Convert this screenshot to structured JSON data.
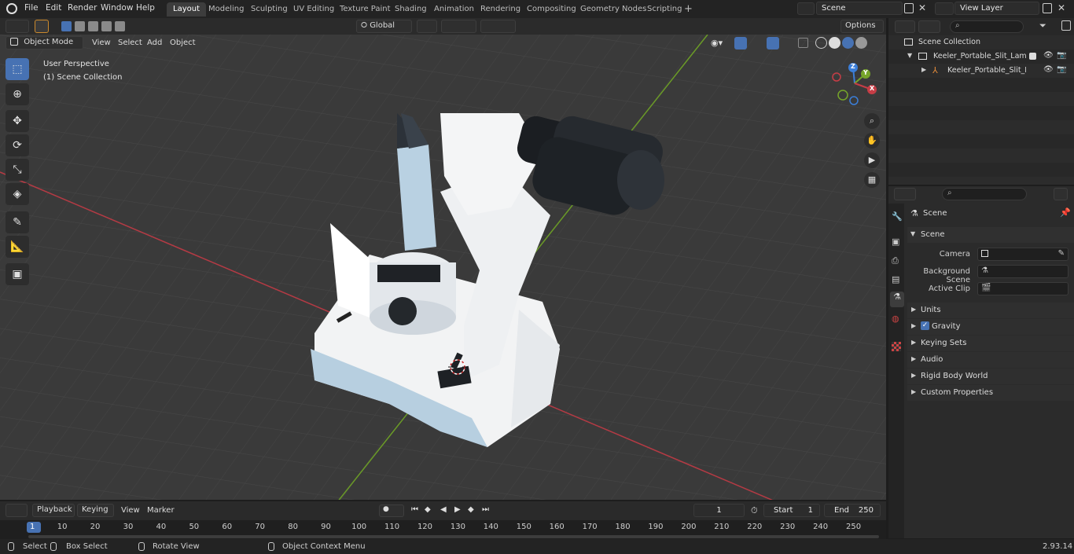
{
  "menu": [
    "File",
    "Edit",
    "Render",
    "Window",
    "Help"
  ],
  "workspaces": [
    "Layout",
    "Modeling",
    "Sculpting",
    "UV Editing",
    "Texture Paint",
    "Shading",
    "Animation",
    "Rendering",
    "Compositing",
    "Geometry Nodes",
    "Scripting"
  ],
  "active_workspace": "Layout",
  "scene_field": "Scene",
  "view_layer_field": "View Layer",
  "viewport_header": {
    "mode": "Object Mode",
    "links": [
      "View",
      "Select",
      "Add",
      "Object"
    ],
    "orientation": "Global",
    "options": "Options"
  },
  "viewport_overlay": {
    "perspective": "User Perspective",
    "collection": "(1) Scene Collection"
  },
  "gizmo": {
    "z": "Z",
    "y": "Y",
    "x": "X"
  },
  "outliner": {
    "root": "Scene Collection",
    "items": [
      "Keeler_Portable_Slit_Lamp_Cl",
      "Keeler_Portable_Slit_Larr"
    ]
  },
  "properties": {
    "header": "Scene",
    "section": "Scene",
    "fields": [
      {
        "label": "Camera"
      },
      {
        "label": "Background Scene"
      },
      {
        "label": "Active Clip"
      }
    ],
    "panels": [
      "Units",
      "Gravity",
      "Keying Sets",
      "Audio",
      "Rigid Body World",
      "Custom Properties"
    ]
  },
  "timeline": {
    "menus": [
      "Playback",
      "Keying",
      "View",
      "Marker"
    ],
    "current_frame": "1",
    "start_label": "Start",
    "start_value": "1",
    "end_label": "End",
    "end_value": "250",
    "ticks": [
      "1",
      "10",
      "20",
      "30",
      "40",
      "50",
      "60",
      "70",
      "80",
      "90",
      "100",
      "110",
      "120",
      "130",
      "140",
      "150",
      "160",
      "170",
      "180",
      "190",
      "200",
      "210",
      "220",
      "230",
      "240",
      "250"
    ]
  },
  "status": {
    "select": "Select",
    "box_select": "Box Select",
    "rotate_view": "Rotate View",
    "context_menu": "Object Context Menu",
    "version": "2.93.14"
  },
  "colors": {
    "accent": "#4772b3",
    "x_axis": "#c63d46",
    "y_axis": "#76a52a",
    "z_axis": "#3b7ed8"
  }
}
